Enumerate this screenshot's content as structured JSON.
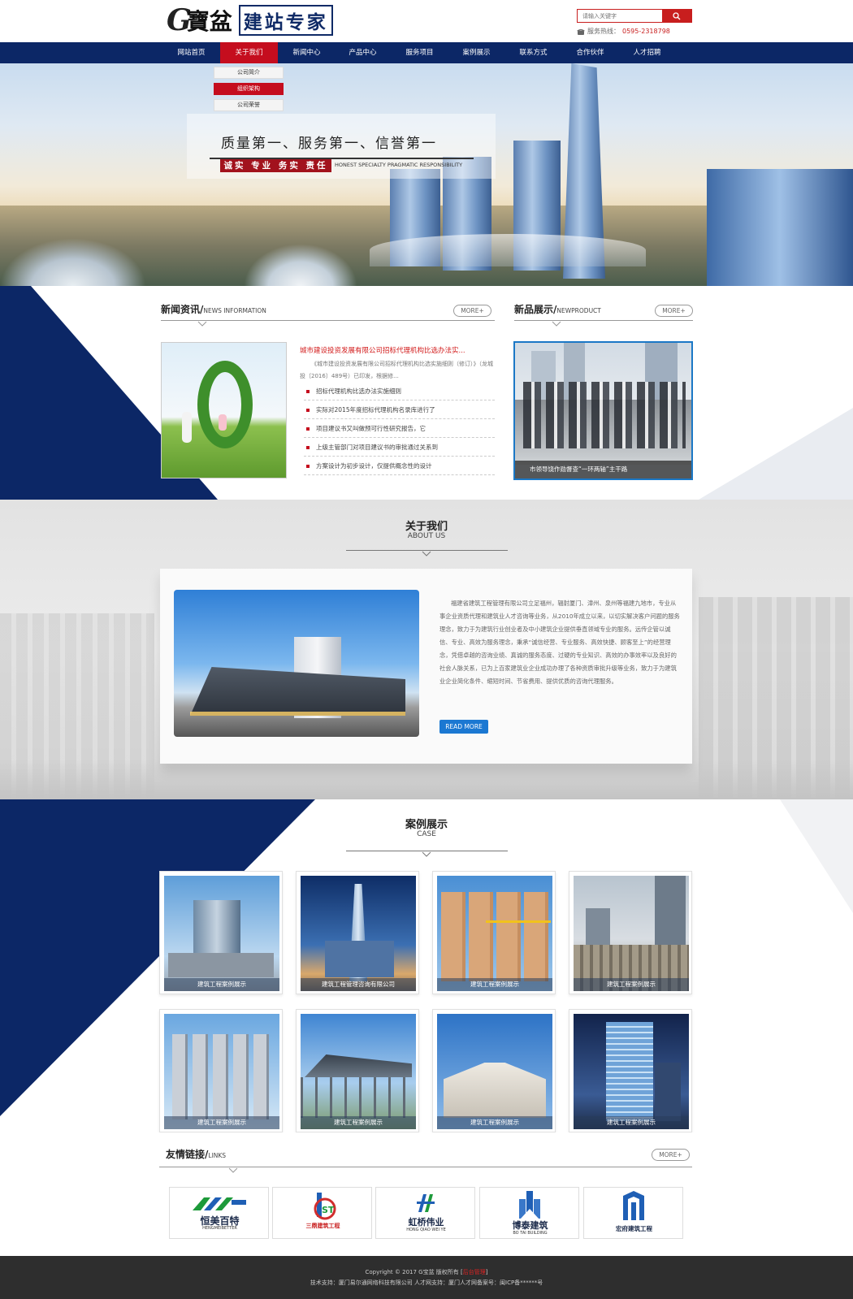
{
  "header": {
    "logo_g": "G",
    "logo_bao": "寶盆",
    "logo_slogan": "建站专家",
    "search_placeholder": "请输入关键字",
    "hotline_label": "服务热线：",
    "hotline_number": "0595-2318798"
  },
  "nav": {
    "items": [
      "网站首页",
      "关于我们",
      "新闻中心",
      "产品中心",
      "服务项目",
      "案例展示",
      "联系方式",
      "合作伙伴",
      "人才招聘"
    ],
    "active_index": 1,
    "submenu": [
      "公司简介",
      "组织架构",
      "公司荣誉"
    ],
    "submenu_active_index": 1
  },
  "banner": {
    "title": "质量第一、服务第一、信誉第一",
    "red_label": "诚实 专业 务实 责任",
    "en_text": "HONEST SPECIALTY PRAGMATIC RESPONSIBILITY"
  },
  "news": {
    "heading": "新闻资讯/",
    "heading_en": "NEWS INFORMATION",
    "more": "MORE+",
    "featured_title": "城市建设投资发展有限公司招标代理机构比选办法实...",
    "featured_desc": "《城市建设投资发展有限公司招标代理机构比选实施细则（修订）》（龙城投〔2016〕489号）已印发，根据修...",
    "items": [
      "招标代理机构比选办法实施细则",
      "实际对2015年度招标代理机构名录库进行了",
      "项目建议书又叫做预可行性研究报告，它",
      "上级主管部门对项目建议书的审批通过关系到",
      "方案设计为初步设计，仅提供概念性的设计"
    ]
  },
  "product": {
    "heading": "新品展示/",
    "heading_en": "NEWPRODUCT",
    "more": "MORE+",
    "caption": "市领导饶作勋督查“一环两轴”主干路"
  },
  "about": {
    "heading": "关于我们",
    "heading_en": "ABOUT US",
    "text": "福建省建筑工程管理有限公司立足福州，辐射厦门、漳州、泉州等福建九地市，专业从事企业资质代理和建筑业人才咨询等业务，从2010年成立以来，以切实解决客户问题的服务理念，致力于为建筑行业创业者及中小建筑企业提供垂直领域专业的服务。远传企管以诚信、专业、高效为服务理念，秉承“诚信经营、专业服务、高效快捷、顾客至上”的经营理念，凭借卓越的咨询业绩、真诚的服务态度、过硬的专业知识、高效的办事效率以及良好的社会人脉关系，已为上百家建筑业企业成功办理了各种资质审批升级等业务，致力于为建筑业企业简化条件、缩短时间、节省费用、提供优质的咨询代理服务。",
    "button": "READ MORE"
  },
  "cases": {
    "heading": "案例展示",
    "heading_en": "CASE",
    "items": [
      "建筑工程案例展示",
      "建筑工程管理咨询有限公司",
      "建筑工程案例展示",
      "建筑工程案例展示",
      "建筑工程案例展示",
      "建筑工程案例展示",
      "建筑工程案例展示",
      "建筑工程案例展示"
    ]
  },
  "links": {
    "heading": "友情链接/",
    "heading_en": "LINKS",
    "more": "MORE+",
    "items": [
      {
        "name": "恒美百特",
        "sub": "HENGMEIBETTER"
      },
      {
        "name": "三鼎建筑工程",
        "sub": ""
      },
      {
        "name": "虹桥伟业",
        "sub": "HONG QIAO WEI YE"
      },
      {
        "name": "博泰建筑",
        "sub": "BO TAI BUILDING"
      },
      {
        "name": "宏府建筑工程",
        "sub": ""
      }
    ]
  },
  "footer": {
    "copyright_prefix": "Copyright © 2017 G宝盆 版权所有 [",
    "admin_link": "后台管理",
    "copyright_suffix": "]",
    "support": "技术支持：厦门易尔通网络科技有限公司 人才网支持：厦门人才网备案号：闽ICP备******号"
  },
  "colors": {
    "nav_bg": "#0c2766",
    "accent_red": "#c50d1e",
    "accent_blue": "#1b78d2"
  }
}
